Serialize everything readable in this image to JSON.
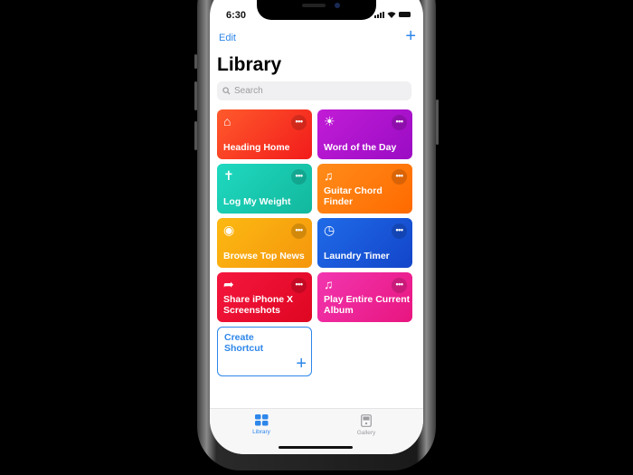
{
  "status_bar": {
    "time": "6:30"
  },
  "nav": {
    "edit_label": "Edit",
    "add_label": "+"
  },
  "header": {
    "title": "Library"
  },
  "search": {
    "placeholder": "Search"
  },
  "shortcuts": [
    {
      "label": "Heading Home",
      "icon": "house-icon",
      "glyph": "⌂",
      "color_from": "#ff5a2c",
      "color_to": "#f21b1b"
    },
    {
      "label": "Word of the Day",
      "icon": "sun-icon",
      "glyph": "☀",
      "color_from": "#c21cd6",
      "color_to": "#9a0cc4"
    },
    {
      "label": "Log My Weight",
      "icon": "person-icon",
      "glyph": "✝",
      "color_from": "#1fd9c0",
      "color_to": "#12b89d"
    },
    {
      "label": "Guitar Chord Finder",
      "icon": "music-note-icon",
      "glyph": "♫",
      "color_from": "#ff8c1a",
      "color_to": "#ff6a00"
    },
    {
      "label": "Browse Top News",
      "icon": "globe-icon",
      "glyph": "◉",
      "color_from": "#fcb912",
      "color_to": "#f5960c"
    },
    {
      "label": "Laundry Timer",
      "icon": "clock-icon",
      "glyph": "◷",
      "color_from": "#1f6be8",
      "color_to": "#1345c9"
    },
    {
      "label": "Share iPhone X Screenshots",
      "icon": "share-arrow-icon",
      "glyph": "➦",
      "color_from": "#f5173f",
      "color_to": "#de0621"
    },
    {
      "label": "Play Entire Current Album",
      "icon": "music-note-icon",
      "glyph": "♫",
      "color_from": "#f236b0",
      "color_to": "#e8157f"
    }
  ],
  "more_glyph": "•••",
  "create": {
    "label": "Create Shortcut",
    "plus": "+"
  },
  "tabs": [
    {
      "label": "Library",
      "active": true
    },
    {
      "label": "Gallery",
      "active": false
    }
  ],
  "colors": {
    "accent": "#2d86ea",
    "inactive": "#9b9ba0"
  }
}
